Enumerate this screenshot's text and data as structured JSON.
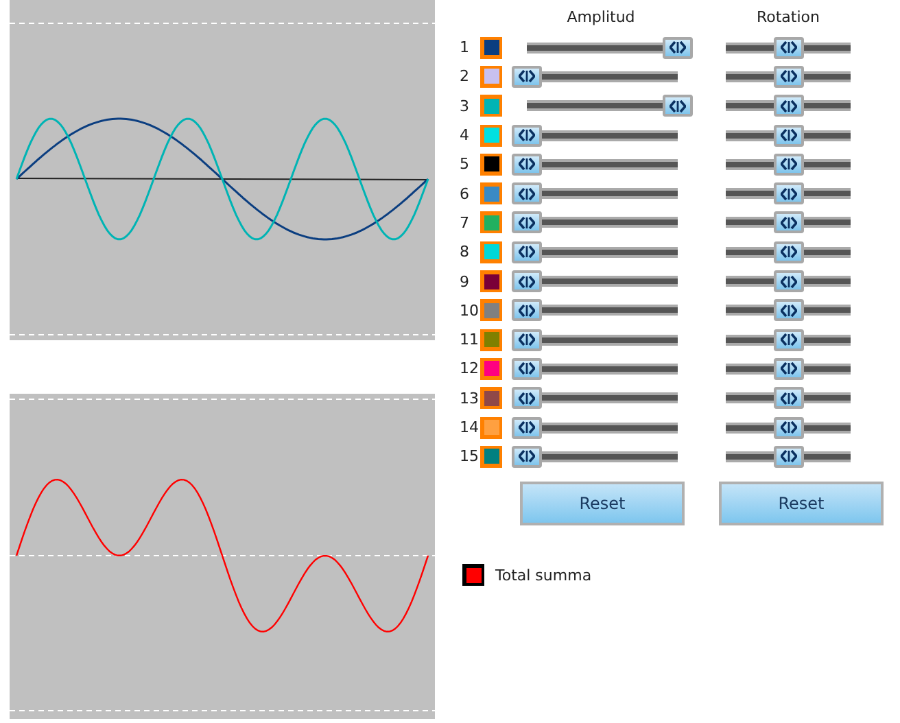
{
  "columns": [
    "Amplitud",
    "Rotation"
  ],
  "harmonics": [
    {
      "number": "1",
      "color": "#0b3e80",
      "amplitude": {
        "level": 1
      },
      "rotation": {
        "level": 0.5
      }
    },
    {
      "number": "2",
      "color": "#c8c0f0",
      "amplitude": {
        "level": 0
      },
      "rotation": {
        "level": 0.5
      }
    },
    {
      "number": "3",
      "color": "#00b4b4",
      "amplitude": {
        "level": 1
      },
      "rotation": {
        "level": 0.5
      }
    },
    {
      "number": "4",
      "color": "#00e0e0",
      "amplitude": {
        "level": 0
      },
      "rotation": {
        "level": 0.5
      }
    },
    {
      "number": "5",
      "color": "#000000",
      "amplitude": {
        "level": 0
      },
      "rotation": {
        "level": 0.5
      }
    },
    {
      "number": "6",
      "color": "#3a8ac4",
      "amplitude": {
        "level": 0
      },
      "rotation": {
        "level": 0.5
      }
    },
    {
      "number": "7",
      "color": "#22b060",
      "amplitude": {
        "level": 0
      },
      "rotation": {
        "level": 0.5
      }
    },
    {
      "number": "8",
      "color": "#00d8d8",
      "amplitude": {
        "level": 0
      },
      "rotation": {
        "level": 0.5
      }
    },
    {
      "number": "9",
      "color": "#7a0038",
      "amplitude": {
        "level": 0
      },
      "rotation": {
        "level": 0.5
      }
    },
    {
      "number": "10",
      "color": "#808080",
      "amplitude": {
        "level": 0
      },
      "rotation": {
        "level": 0.5
      }
    },
    {
      "number": "11",
      "color": "#808000",
      "amplitude": {
        "level": 0
      },
      "rotation": {
        "level": 0.5
      }
    },
    {
      "number": "12",
      "color": "#ff0080",
      "amplitude": {
        "level": 0
      },
      "rotation": {
        "level": 0.5
      }
    },
    {
      "number": "13",
      "color": "#904848",
      "amplitude": {
        "level": 0
      },
      "rotation": {
        "level": 0.5
      }
    },
    {
      "number": "14",
      "color": "#ffa040",
      "amplitude": {
        "level": 0
      },
      "rotation": {
        "level": 0.5
      }
    },
    {
      "number": "15",
      "color": "#008080",
      "amplitude": {
        "level": 0
      },
      "rotation": {
        "level": 0.5
      }
    }
  ],
  "buttons": [
    {
      "label": "Reset"
    },
    {
      "label": "Reset"
    }
  ],
  "total": {
    "label": "Total summa",
    "color": "#ff0000"
  }
}
